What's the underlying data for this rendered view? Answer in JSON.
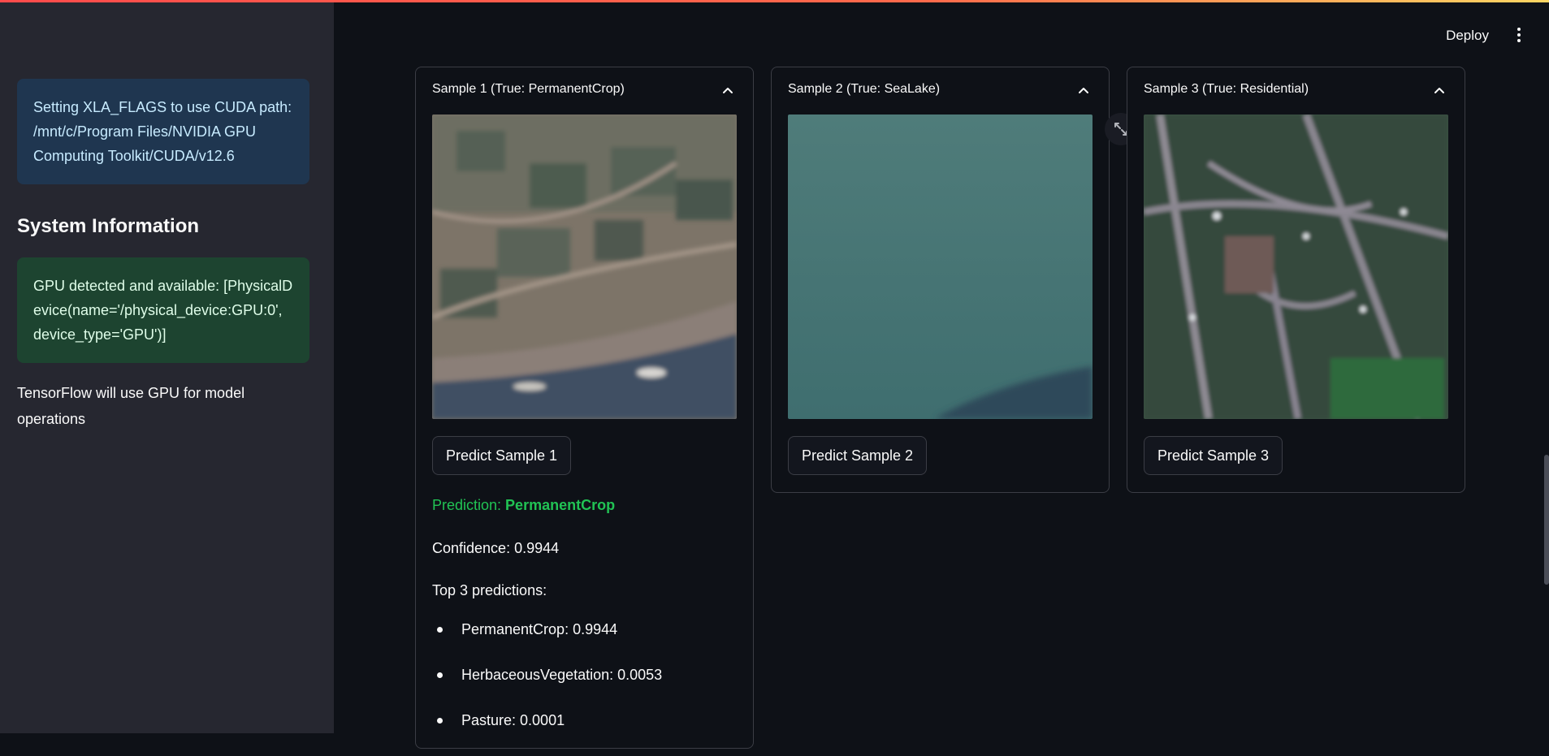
{
  "sidebar": {
    "cuda_alert": "Setting XLA_FLAGS to use CUDA path: /mnt/c/Program Files/NVIDIA GPU Computing Toolkit/CUDA/v12.6",
    "section_title": "System Information",
    "gpu_alert": "GPU detected and available: [PhysicalDevice(name='/physical_device:GPU:0', device_type='GPU')]",
    "tf_note": "TensorFlow will use GPU for model operations"
  },
  "header": {
    "deploy_label": "Deploy",
    "menu_icon": "more-vertical-icon"
  },
  "samples": [
    {
      "title": "Sample 1 (True: PermanentCrop)",
      "button": "Predict Sample 1"
    },
    {
      "title": "Sample 2 (True: SeaLake)",
      "button": "Predict Sample 2"
    },
    {
      "title": "Sample 3 (True: Residential)",
      "button": "Predict Sample 3"
    }
  ],
  "prediction": {
    "label_prefix": "Prediction: ",
    "label_value": "PermanentCrop",
    "confidence": "Confidence: 0.9944",
    "top_title": "Top 3 predictions:",
    "top": [
      "PermanentCrop: 0.9944",
      "HerbaceousVegetation: 0.0053",
      "Pasture: 0.0001"
    ]
  },
  "colors": {
    "background": "#0e1117",
    "sidebar": "#262730",
    "info_alert": "#1f3650",
    "success_alert": "#1d4430",
    "prediction_green": "#21c354"
  }
}
